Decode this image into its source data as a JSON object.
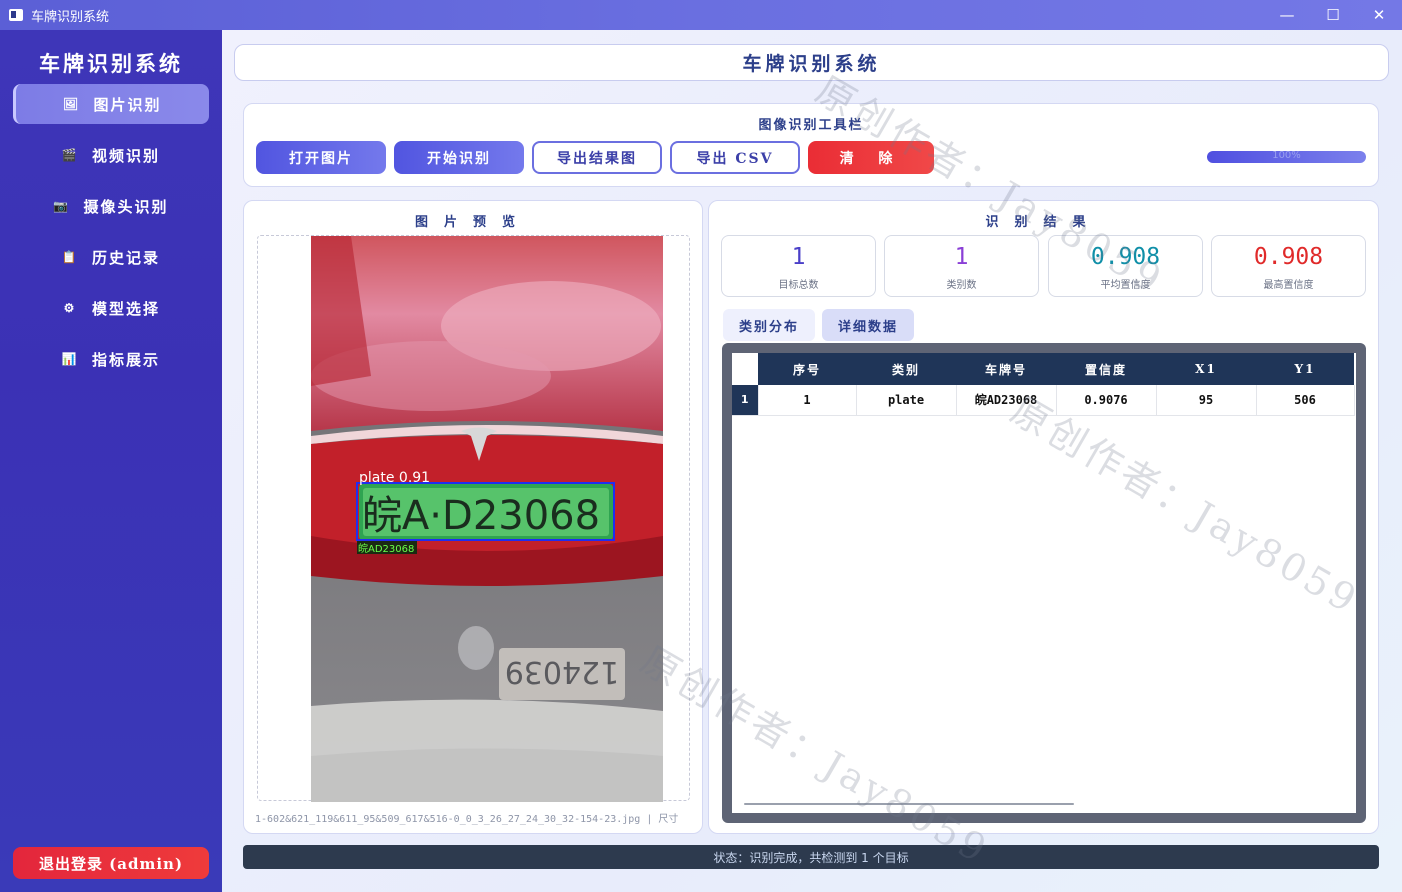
{
  "window": {
    "title": "车牌识别系统",
    "controls": [
      "—",
      "☐",
      "✕"
    ]
  },
  "sidebar": {
    "brand": "车牌识别系统",
    "items": [
      {
        "label": "图片识别",
        "icon": "image-icon",
        "glyph": "🖼",
        "active": true
      },
      {
        "label": "视频识别",
        "icon": "clapperboard-icon",
        "glyph": "🎬",
        "active": false
      },
      {
        "label": "摄像头识别",
        "icon": "camera-icon",
        "glyph": "📷",
        "active": false
      },
      {
        "label": "历史记录",
        "icon": "clipboard-icon",
        "glyph": "📋",
        "active": false
      },
      {
        "label": "模型选择",
        "icon": "gear-icon",
        "glyph": "⚙",
        "active": false
      },
      {
        "label": "指标展示",
        "icon": "bar-chart-icon",
        "glyph": "📊",
        "active": false
      }
    ],
    "logout_label": "退出登录 (admin)"
  },
  "header": {
    "title": "车牌识别系统"
  },
  "toolbar": {
    "title": "图像识别工具栏",
    "open_label": "打开图片",
    "start_label": "开始识别",
    "export_image_label": "导出结果图",
    "export_csv_label": "导出 CSV",
    "clear_label": "清 除",
    "progress": 100,
    "progress_text": "100%"
  },
  "preview": {
    "title": "图片预览",
    "detection_label": "plate 0.91",
    "plate_text_label": "皖AD23068",
    "plate_image_text": "皖A·D23068",
    "ground_plate_text": "124039",
    "file_caption": "1-602&621_119&611_95&509_617&516-0_0_3_26_27_24_30_32-154-23.jpg  |  尺寸"
  },
  "results": {
    "title": "识别结果",
    "cards": [
      {
        "value": "1",
        "label": "目标总数",
        "color": "#4a3fc8"
      },
      {
        "value": "1",
        "label": "类别数",
        "color": "#8a3fd6"
      },
      {
        "value": "0.908",
        "label": "平均置信度",
        "color": "#0f8fa8"
      },
      {
        "value": "0.908",
        "label": "最高置信度",
        "color": "#e02a2a"
      }
    ],
    "tabs": [
      "类别分布",
      "详细数据"
    ],
    "columns": [
      "序号",
      "类别",
      "车牌号",
      "置信度",
      "X1",
      "Y1"
    ],
    "rows": [
      {
        "num": "1",
        "cells": [
          "1",
          "plate",
          "皖AD23068",
          "0.9076",
          "95",
          "506"
        ]
      }
    ]
  },
  "status": {
    "text": "状态：识别完成，共检测到 1 个目标"
  },
  "watermark": "原创作者：Jay8059"
}
